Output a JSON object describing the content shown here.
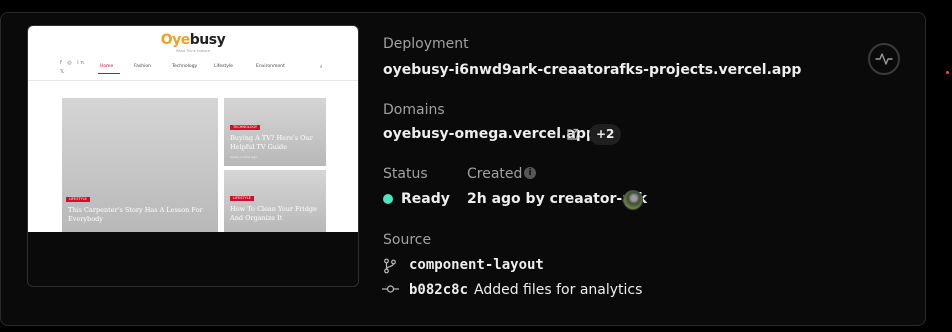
{
  "preview": {
    "logo_part1": "Oye",
    "logo_part2": "busy",
    "tagline": "Read Think Explore",
    "socials_row1": "f ◎ in",
    "socials_row2": "𝕏",
    "nav": [
      "Home",
      "Fashion",
      "Technology",
      "Lifestyle",
      "Environment"
    ],
    "nav_search": "⌕",
    "articles": [
      {
        "category": "LIFESTYLE",
        "title": "This Carpenter's Story Has A Lesson For Everybody"
      },
      {
        "category": "TECHNOLOGY",
        "title": "Buying A TV? Here's Our Helpful TV Guide",
        "meta": "admin   2 mins ago"
      },
      {
        "category": "LIFESTYLE",
        "title": "How To Clean Your Fridge And Organize It"
      }
    ]
  },
  "deployment": {
    "label": "Deployment",
    "url": "oyebusy-i6nwd9ark-creaatorafks-projects.vercel.app"
  },
  "domains": {
    "label": "Domains",
    "primary": "oyebusy-omega.vercel.app",
    "extra_count": "+2"
  },
  "status": {
    "label": "Status",
    "value": "Ready",
    "color": "#50e3c2"
  },
  "created": {
    "label": "Created",
    "info_icon": "i",
    "value": "2h ago by creaator-afk"
  },
  "source": {
    "label": "Source",
    "branch": "component-layout",
    "commit_hash": "b082c8c",
    "commit_message": "Added files for analytics"
  }
}
